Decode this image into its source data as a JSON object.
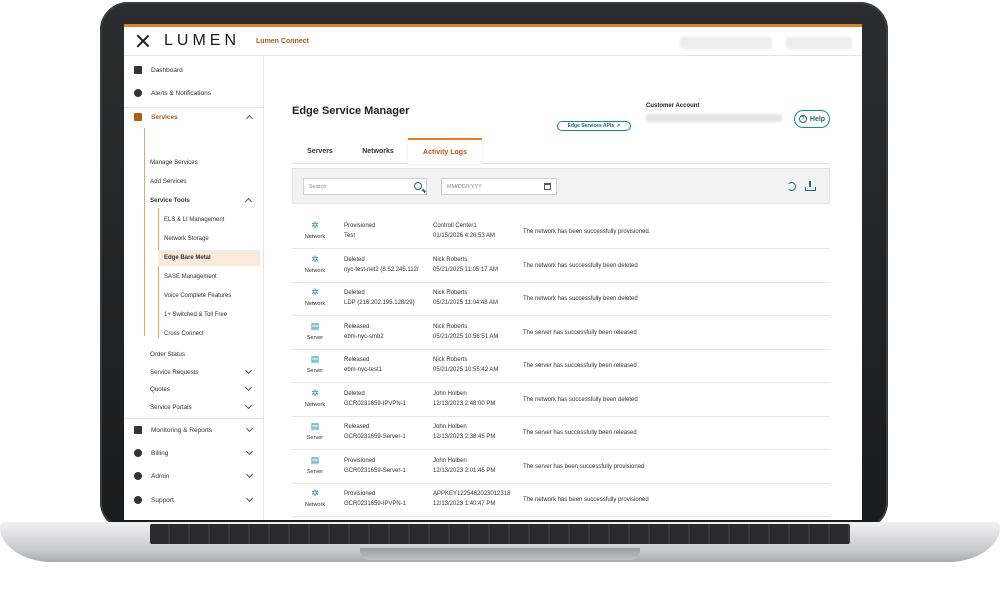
{
  "app": {
    "brand": "LUMEN",
    "product": "Lumen Connect"
  },
  "sidebar": {
    "dashboard": "Dashboard",
    "alerts": "Alerts & Notifications",
    "services": "Services",
    "manage_services": "Manage Services",
    "add_services": "Add Services",
    "service_tools": "Service Tools",
    "tools": [
      "ELS & LI Management",
      "Network Storage",
      "Edge Bare Metal",
      "SASE Management",
      "Voice Complete Features",
      "1+ Switched & Toll Free",
      "Cross Connect"
    ],
    "order_status": "Order Status",
    "service_requests": "Service Requests",
    "quotes": "Quotes",
    "service_portals": "Service Portals",
    "monitoring": "Monitoring & Reports",
    "billing": "Billing",
    "admin": "Admin",
    "support": "Support"
  },
  "header": {
    "title": "Edge Service Manager",
    "api_button": "Edge Services APIs",
    "customer_account_label": "Customer Account",
    "help": "Help"
  },
  "tabs": [
    "Servers",
    "Networks",
    "Activity Logs"
  ],
  "filter": {
    "search_placeholder": "Search",
    "date_placeholder": "MM/DD/YYYY"
  },
  "logs": [
    {
      "type": "Network",
      "action": "Provisioned",
      "target": "Test",
      "user": "Controll Center1",
      "time": "01/15/2026 4:26:53 AM",
      "message": "The network has been successfully provisioned."
    },
    {
      "type": "Network",
      "action": "Deleted",
      "target": "nyc-test-net2 (8.52.245.112/",
      "user": "Nick Roberts",
      "time": "05/21/2025 11:05:17 AM",
      "message": "The network has successfully been deleted"
    },
    {
      "type": "Network",
      "action": "Deleted",
      "target": "LDP (216.202.195.128/29)",
      "user": "Nick Roberts",
      "time": "05/21/2025 11:04:48 AM",
      "message": "The network has successfully been deleted"
    },
    {
      "type": "Server",
      "action": "Released",
      "target": "ebm-nyc-smb2",
      "user": "Nick Roberts",
      "time": "05/21/2025 10:56:51 AM",
      "message": "The server has successfully been released"
    },
    {
      "type": "Server",
      "action": "Released",
      "target": "ebm-nyc-test1",
      "user": "Nick Roberts",
      "time": "05/21/2025 10:55:42 AM",
      "message": "The server has successfully been released"
    },
    {
      "type": "Network",
      "action": "Deleted",
      "target": "GCR0231659-IPVPN-1",
      "user": "John Holben",
      "time": "12/13/2023 2:48:00 PM",
      "message": "The network has successfully been deleted"
    },
    {
      "type": "Server",
      "action": "Released",
      "target": "GCR0231659-Server-1",
      "user": "John Holben",
      "time": "12/13/2023 2:38:45 PM",
      "message": "The server has successfully been released"
    },
    {
      "type": "Server",
      "action": "Provisioned",
      "target": "GCR0231659-Server-1",
      "user": "John Holben",
      "time": "12/13/2023 2:01:46 PM",
      "message": "The server has been successfully provisioned"
    },
    {
      "type": "Network",
      "action": "Provisioned",
      "target": "GCR0231659-IPVPN-1",
      "user": "APPKEY1225462023012318",
      "time": "12/13/2023 1:40:47 PM",
      "message": "The network has been successfully provisioned"
    }
  ],
  "colors": {
    "accent": "#e67e22",
    "active_text": "#b05a12",
    "teal": "#1b8a8a"
  }
}
